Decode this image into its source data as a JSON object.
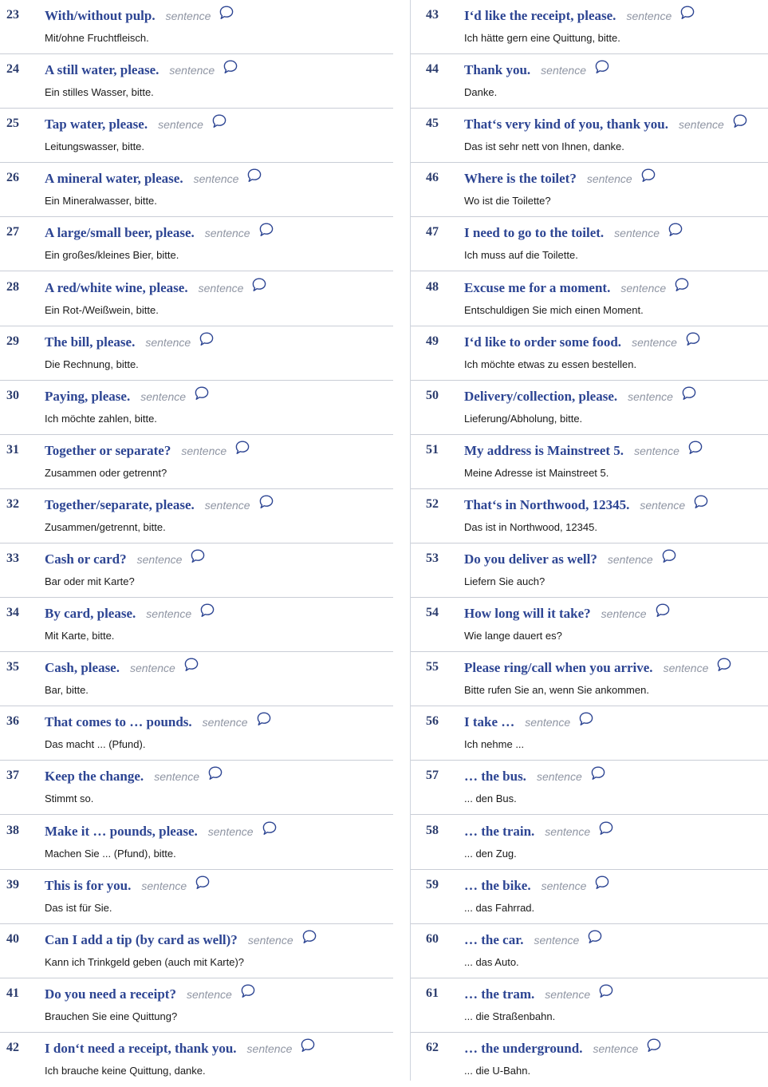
{
  "tag_label": "sentence",
  "colors": {
    "number": "#2c3d6e",
    "english": "#2d4593",
    "tag": "#8f95a3",
    "german": "#1a1a1a",
    "divider": "#c9cdd6"
  },
  "icons": {
    "speak": "speech-bubble-icon"
  },
  "left": [
    {
      "num": "23",
      "en": "With/without pulp.",
      "de": "Mit/ohne Fruchtfleisch."
    },
    {
      "num": "24",
      "en": "A still water, please.",
      "de": "Ein stilles Wasser, bitte."
    },
    {
      "num": "25",
      "en": "Tap water, please.",
      "de": "Leitungswasser, bitte."
    },
    {
      "num": "26",
      "en": "A mineral water, please.",
      "de": "Ein Mineralwasser, bitte."
    },
    {
      "num": "27",
      "en": "A large/small beer, please.",
      "de": "Ein großes/kleines Bier, bitte."
    },
    {
      "num": "28",
      "en": "A red/white wine, please.",
      "de": "Ein Rot-/Weißwein, bitte."
    },
    {
      "num": "29",
      "en": "The bill, please.",
      "de": "Die Rechnung, bitte."
    },
    {
      "num": "30",
      "en": "Paying, please.",
      "de": "Ich möchte zahlen, bitte."
    },
    {
      "num": "31",
      "en": "Together or separate?",
      "de": "Zusammen oder getrennt?"
    },
    {
      "num": "32",
      "en": "Together/separate, please.",
      "de": "Zusammen/getrennt, bitte."
    },
    {
      "num": "33",
      "en": "Cash or card?",
      "de": "Bar oder mit Karte?"
    },
    {
      "num": "34",
      "en": "By card, please.",
      "de": "Mit Karte, bitte."
    },
    {
      "num": "35",
      "en": "Cash, please.",
      "de": "Bar, bitte."
    },
    {
      "num": "36",
      "en": "That comes to … pounds.",
      "de": "Das macht ... (Pfund)."
    },
    {
      "num": "37",
      "en": "Keep the change.",
      "de": "Stimmt so."
    },
    {
      "num": "38",
      "en": "Make it … pounds, please.",
      "de": "Machen Sie ... (Pfund), bitte."
    },
    {
      "num": "39",
      "en": "This is for you.",
      "de": "Das ist für Sie."
    },
    {
      "num": "40",
      "en": "Can I add a tip (by card as well)?",
      "de": "Kann ich Trinkgeld geben (auch mit Karte)?"
    },
    {
      "num": "41",
      "en": "Do you need a receipt?",
      "de": "Brauchen Sie eine Quittung?"
    },
    {
      "num": "42",
      "en": "I don‘t need a receipt, thank you.",
      "de": "Ich brauche keine Quittung, danke."
    }
  ],
  "right": [
    {
      "num": "43",
      "en": "I‘d like the receipt, please.",
      "de": "Ich hätte gern eine Quittung, bitte."
    },
    {
      "num": "44",
      "en": "Thank you.",
      "de": "Danke."
    },
    {
      "num": "45",
      "en": "That‘s very kind of you, thank you.",
      "de": "Das ist sehr nett von Ihnen, danke."
    },
    {
      "num": "46",
      "en": "Where is the toilet?",
      "de": "Wo ist die Toilette?"
    },
    {
      "num": "47",
      "en": "I need to go to the toilet.",
      "de": "Ich muss auf die Toilette."
    },
    {
      "num": "48",
      "en": "Excuse me for a moment.",
      "de": "Entschuldigen Sie mich einen Moment."
    },
    {
      "num": "49",
      "en": "I‘d like to order some food.",
      "de": "Ich möchte etwas zu essen bestellen."
    },
    {
      "num": "50",
      "en": "Delivery/collection, please.",
      "de": "Lieferung/Abholung, bitte."
    },
    {
      "num": "51",
      "en": "My address is Mainstreet 5.",
      "de": "Meine Adresse ist Mainstreet 5."
    },
    {
      "num": "52",
      "en": "That‘s in Northwood, 12345.",
      "de": "Das ist in Northwood, 12345."
    },
    {
      "num": "53",
      "en": "Do you deliver as well?",
      "de": "Liefern Sie auch?"
    },
    {
      "num": "54",
      "en": "How long will it take?",
      "de": "Wie lange dauert es?"
    },
    {
      "num": "55",
      "en": "Please ring/call when you arrive.",
      "de": "Bitte rufen Sie an, wenn Sie ankommen."
    },
    {
      "num": "56",
      "en": "I take …",
      "de": "Ich nehme ..."
    },
    {
      "num": "57",
      "en": "… the bus.",
      "de": "... den Bus."
    },
    {
      "num": "58",
      "en": "… the train.",
      "de": "... den Zug."
    },
    {
      "num": "59",
      "en": "… the bike.",
      "de": "... das Fahrrad."
    },
    {
      "num": "60",
      "en": "… the car.",
      "de": "... das Auto."
    },
    {
      "num": "61",
      "en": "… the tram.",
      "de": "... die Straßenbahn."
    },
    {
      "num": "62",
      "en": "… the underground.",
      "de": "... die U-Bahn."
    }
  ]
}
